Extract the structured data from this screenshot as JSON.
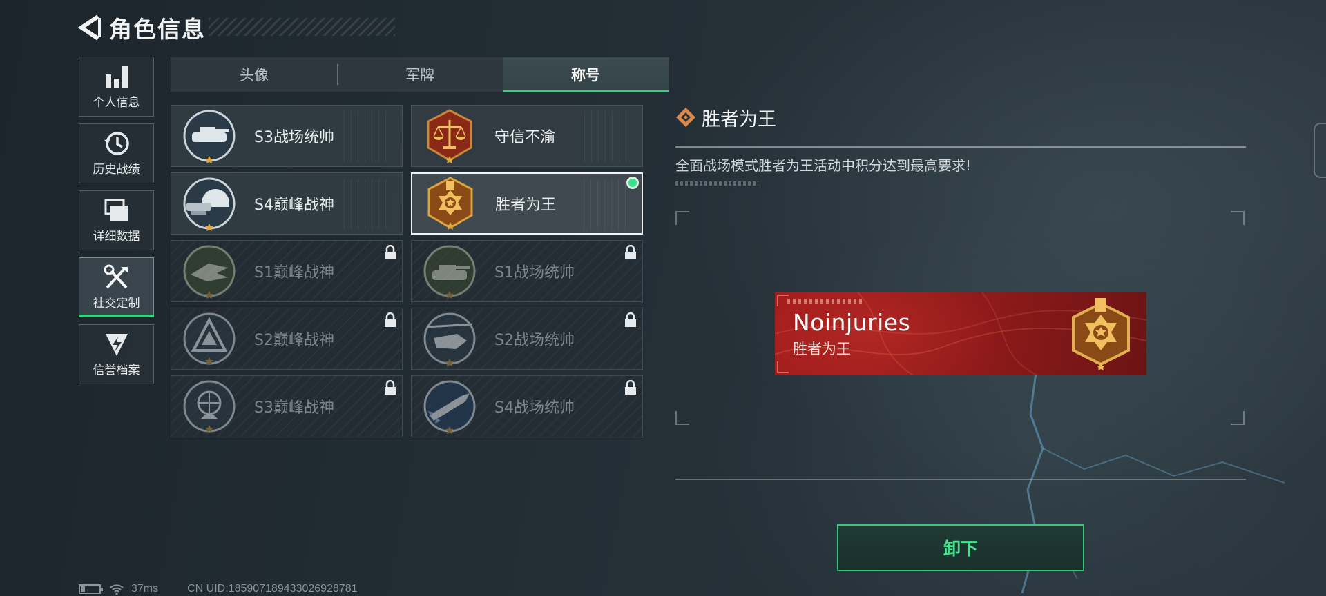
{
  "header": {
    "title": "角色信息",
    "back_icon": "back-arrow-icon"
  },
  "sidenav": {
    "items": [
      {
        "label": "个人信息",
        "icon": "bar-chart-icon",
        "active": false
      },
      {
        "label": "历史战绩",
        "icon": "history-clock-icon",
        "active": false
      },
      {
        "label": "详细数据",
        "icon": "folder-stack-icon",
        "active": false
      },
      {
        "label": "社交定制",
        "icon": "tools-icon",
        "active": true
      },
      {
        "label": "信誉档案",
        "icon": "shield-lightning-icon",
        "active": false
      }
    ]
  },
  "tabs": [
    {
      "label": "头像",
      "active": false
    },
    {
      "label": "军牌",
      "active": false
    },
    {
      "label": "称号",
      "active": true
    }
  ],
  "titles": [
    {
      "label": "S3战场统帅",
      "emblem": "tank-emblem-icon",
      "locked": false,
      "equipped": false
    },
    {
      "label": "守信不渝",
      "emblem": "scales-emblem-icon",
      "locked": false,
      "equipped": false
    },
    {
      "label": "S4巅峰战神",
      "emblem": "helmet-emblem-icon",
      "locked": false,
      "equipped": false
    },
    {
      "label": "胜者为王",
      "emblem": "medal-emblem-icon",
      "locked": false,
      "equipped": true
    },
    {
      "label": "S1巅峰战神",
      "emblem": "crocodile-emblem-icon",
      "locked": true,
      "equipped": false
    },
    {
      "label": "S1战场统帅",
      "emblem": "tank-emblem-icon",
      "locked": true,
      "equipped": false
    },
    {
      "label": "S2巅峰战神",
      "emblem": "triangle-emblem-icon",
      "locked": true,
      "equipped": false
    },
    {
      "label": "S2战场统帅",
      "emblem": "helicopter-emblem-icon",
      "locked": true,
      "equipped": false
    },
    {
      "label": "S3巅峰战神",
      "emblem": "globe-emblem-icon",
      "locked": true,
      "equipped": false
    },
    {
      "label": "S4战场统帅",
      "emblem": "missile-emblem-icon",
      "locked": true,
      "equipped": false
    }
  ],
  "detail": {
    "title": "胜者为王",
    "description": "全面战场模式胜者为王活动中积分达到最高要求!",
    "banner": {
      "player_name": "Noinjuries",
      "title_text": "胜者为王"
    }
  },
  "action_button": {
    "label": "卸下"
  },
  "status": {
    "ping": "37ms",
    "uid": "CN UID:185907189433026928781"
  },
  "colors": {
    "accent_green": "#33d37a",
    "banner_red": "#a31d1d",
    "gold": "#d9a441"
  }
}
